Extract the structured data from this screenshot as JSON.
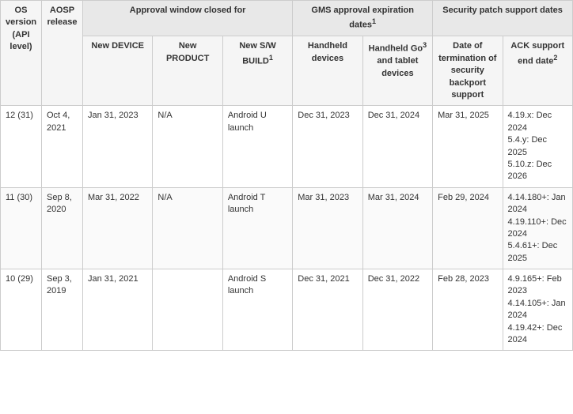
{
  "table": {
    "group_headers": {
      "approval_window": "Approval window closed for",
      "gms_approval": "GMS approval expiration dates",
      "gms_note": "1",
      "security_patch": "Security patch support dates"
    },
    "column_headers": {
      "os_version": "OS version (API level)",
      "aosp_release": "AOSP release",
      "new_device": "New DEVICE",
      "new_product": "New PRODUCT",
      "new_sw_build": "New S/W BUILD",
      "new_sw_note": "1",
      "handheld_devices": "Handheld devices",
      "handheld_go": "Handheld Go",
      "handheld_go_note": "3",
      "handheld_go_suffix": " and tablet devices",
      "date_termination": "Date of termination of security backport support",
      "ack_support": "ACK support end date",
      "ack_note": "2"
    },
    "rows": [
      {
        "os_version": "12 (31)",
        "aosp_release": "Oct 4, 2021",
        "new_device": "Jan 31, 2023",
        "new_product": "N/A",
        "new_sw_build": "Android U launch",
        "handheld_devices": "Dec 31, 2023",
        "handheld_go": "Dec 31, 2024",
        "date_termination": "Mar 31, 2025",
        "ack_support": "4.19.x: Dec 2024\n5.4.y: Dec 2025\n5.10.z: Dec 2026"
      },
      {
        "os_version": "11 (30)",
        "aosp_release": "Sep 8, 2020",
        "new_device": "Mar 31, 2022",
        "new_product": "N/A",
        "new_sw_build": "Android T launch",
        "handheld_devices": "Mar 31, 2023",
        "handheld_go": "Mar 31, 2024",
        "date_termination": "Feb 29, 2024",
        "ack_support": "4.14.180+: Jan 2024\n4.19.110+: Dec 2024\n5.4.61+: Dec 2025"
      },
      {
        "os_version": "10 (29)",
        "aosp_release": "Sep 3, 2019",
        "new_device": "Jan 31, 2021",
        "new_product": "",
        "new_sw_build": "Android S launch",
        "handheld_devices": "Dec 31, 2021",
        "handheld_go": "Dec 31, 2022",
        "date_termination": "Feb 28, 2023",
        "ack_support": "4.9.165+: Feb 2023\n4.14.105+: Jan 2024\n4.19.42+: Dec 2024"
      }
    ]
  }
}
